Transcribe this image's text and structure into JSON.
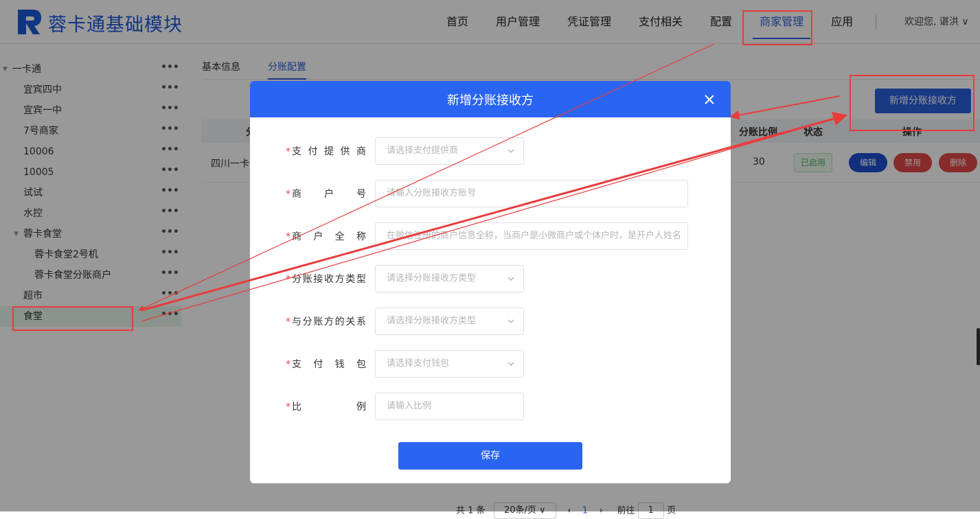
{
  "brand": {
    "title": "蓉卡通基础模块"
  },
  "nav": {
    "items": [
      {
        "label": "首页"
      },
      {
        "label": "用户管理"
      },
      {
        "label": "凭证管理"
      },
      {
        "label": "支付相关"
      },
      {
        "label": "配置"
      },
      {
        "label": "商家管理"
      },
      {
        "label": "应用"
      }
    ],
    "active_index": 5,
    "welcome": "欢迎您, 谌洪 ∨"
  },
  "sidebar": {
    "items": [
      {
        "label": "一卡通",
        "level": 0,
        "expanded": true
      },
      {
        "label": "宜宾四中",
        "level": 1
      },
      {
        "label": "宜宾一中",
        "level": 1
      },
      {
        "label": "7号商家",
        "level": 1
      },
      {
        "label": "10006",
        "level": 1
      },
      {
        "label": "10005",
        "level": 1
      },
      {
        "label": "试试",
        "level": 1
      },
      {
        "label": "水控",
        "level": 1
      },
      {
        "label": "蓉卡食堂",
        "level": 1,
        "expanded": true
      },
      {
        "label": "蓉卡食堂2号机",
        "level": 2
      },
      {
        "label": "蓉卡食堂分账商户",
        "level": 2
      },
      {
        "label": "超市",
        "level": 1
      },
      {
        "label": "食堂",
        "level": 1,
        "selected": true
      }
    ],
    "more": "•••"
  },
  "tabs": [
    {
      "label": "基本信息"
    },
    {
      "label": "分账配置"
    }
  ],
  "toolbar": {
    "add_label": "新增分账接收方"
  },
  "table": {
    "headers": {
      "name": "分",
      "ratio": "分账比例",
      "status": "状态",
      "ops": "操作"
    },
    "row": {
      "name": "四川一卡",
      "ratio": "30",
      "status": "已启用",
      "edit": "编辑",
      "disable": "禁用",
      "delete": "删除"
    }
  },
  "pager": {
    "total": "共 1 条",
    "size": "20条/页 ∨",
    "prev": "‹",
    "page": "1",
    "next": "›",
    "goto": "前往",
    "goto_page": "1",
    "unit": "页"
  },
  "dialog": {
    "title": "新增分账接收方",
    "fields": [
      {
        "label": "支付提供商",
        "placeholder": "请选择支付提供商"
      },
      {
        "label": "商户号",
        "placeholder": "请输入分账接收方账号"
      },
      {
        "label": "商户全称",
        "placeholder": "在微信注册的商户信息全称，当商户是小微商户或个体户时，是开户人姓名"
      },
      {
        "label": "分账接收方类型",
        "placeholder": "请选择分账接收方类型"
      },
      {
        "label": "与分账方的关系",
        "placeholder": "请选择分账接收方类型"
      },
      {
        "label": "支付钱包",
        "placeholder": "请选择支付钱包"
      },
      {
        "label": "比例",
        "placeholder": "请输入比例"
      }
    ],
    "required_mark": "*",
    "save_label": "保存"
  },
  "colors": {
    "primary": "#2965f2",
    "danger": "#e24848",
    "annotation": "#e83c3c"
  }
}
